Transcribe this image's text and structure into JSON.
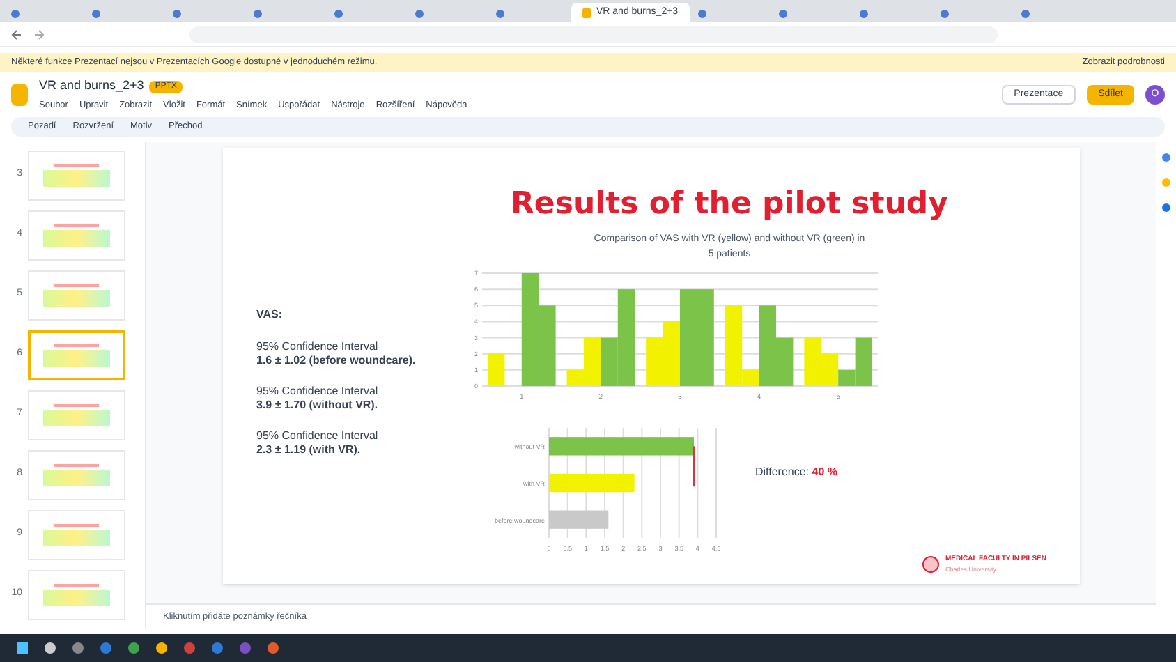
{
  "browser": {
    "tabs": [
      {
        "selected": false
      },
      {
        "selected": false
      },
      {
        "selected": false
      },
      {
        "selected": false
      },
      {
        "selected": false
      },
      {
        "selected": false
      },
      {
        "selected": false
      },
      {
        "title": "VR and burns_2+3",
        "selected": true
      },
      {
        "selected": false
      },
      {
        "selected": false
      },
      {
        "selected": false
      },
      {
        "selected": false
      },
      {
        "selected": false
      }
    ]
  },
  "notice": {
    "text": "Některé funkce Prezentací nejsou v Prezentacích Google dostupné v jednoduchém režimu.",
    "action": "Zobrazit podrobnosti"
  },
  "document": {
    "title": "VR and burns_2+3",
    "badge": "PPTX",
    "menu": [
      "Soubor",
      "Upravit",
      "Zobrazit",
      "Vložit",
      "Formát",
      "Snímek",
      "Uspořádat",
      "Nástroje",
      "Rozšíření",
      "Nápověda"
    ],
    "present_button": "Prezentace",
    "share_button": "Sdílet",
    "avatar": "O"
  },
  "toolbar": {
    "items": [
      "Pozadí",
      "Rozvržení",
      "Motiv",
      "Přechod"
    ]
  },
  "filmstrip": {
    "slides": [
      {
        "number": "3",
        "selected": false
      },
      {
        "number": "4",
        "selected": false
      },
      {
        "number": "5",
        "selected": false
      },
      {
        "number": "6",
        "selected": true
      },
      {
        "number": "7",
        "selected": false
      },
      {
        "number": "8",
        "selected": false
      },
      {
        "number": "9",
        "selected": false
      },
      {
        "number": "10",
        "selected": false
      }
    ]
  },
  "slide": {
    "title": "Results of the pilot study",
    "left_text": [
      {
        "kind": "heading",
        "text": "VAS:"
      },
      {
        "kind": "interval",
        "label": "95% Confidence Interval",
        "value": "1.6 ± 1.02 (before woundcare)."
      },
      {
        "kind": "interval",
        "label": "95% Confidence Interval",
        "value": "3.9 ± 1.70 (without VR)."
      },
      {
        "kind": "interval",
        "label": "95% Confidence Interval",
        "value": "2.3 ± 1.19 (with VR)."
      }
    ],
    "chart_data": {
      "type": "bar",
      "title": "Comparison of VAS with VR (yellow) and without VR (green) in 5 patients",
      "categories": [
        "1",
        "2",
        "3",
        "4",
        "5"
      ],
      "series": [
        {
          "color": "#f2f200",
          "values": [
            2,
            1,
            3,
            5,
            3
          ]
        },
        {
          "color": "#f2f200",
          "values": [
            null,
            3,
            4,
            1,
            2
          ]
        },
        {
          "color": "#7cc34a",
          "values": [
            7,
            3,
            6,
            5,
            1
          ]
        },
        {
          "color": "#7cc34a",
          "values": [
            5,
            6,
            6,
            3,
            3
          ]
        }
      ],
      "grid": true,
      "ylim": [
        0,
        7
      ],
      "yticks": [
        0,
        1,
        2,
        3,
        4,
        5,
        6,
        7
      ]
    },
    "summary_chart": {
      "chart_data": {
        "type": "bar",
        "orientation": "horizontal",
        "categories": [
          "without VR",
          "with VR",
          "before woundcare"
        ],
        "series": [
          {
            "values": [
              3.9,
              2.3,
              1.6
            ]
          }
        ],
        "colors": [
          "#7cc34a",
          "#f2f200",
          "#c9c9c9"
        ],
        "grid": true,
        "xlim": [
          0,
          4.5
        ],
        "xticks": [
          0,
          0.5,
          1,
          1.5,
          2,
          2.5,
          3,
          3.5,
          4,
          4.5
        ]
      },
      "difference_marker": {
        "color": "#e03040"
      }
    },
    "difference": {
      "label": "Difference:",
      "value": "40 %"
    },
    "logo": {
      "name": "MEDICAL FACULTY IN PILSEN",
      "subtitle": "Charles University"
    }
  },
  "notes": {
    "placeholder": "Kliknutím přidáte poznámky řečníka"
  }
}
